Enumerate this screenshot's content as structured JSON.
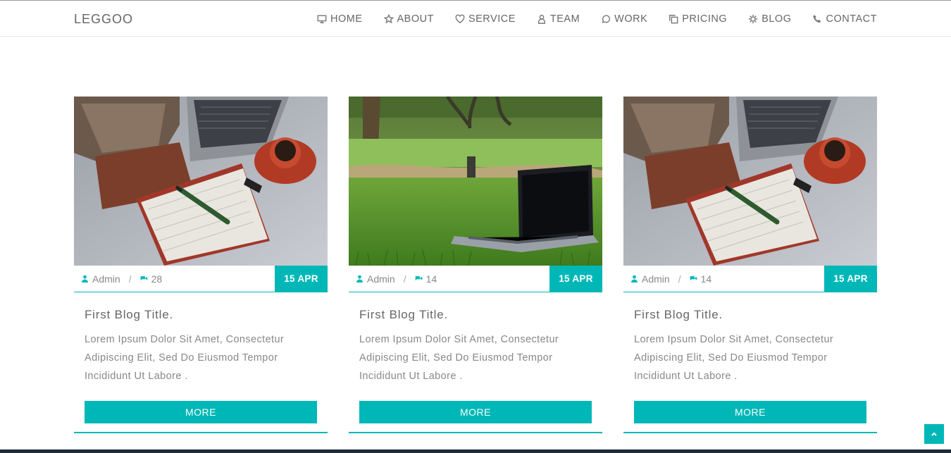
{
  "brand": "LEGGOO",
  "nav": [
    {
      "label": "HOME",
      "icon": "monitor-icon"
    },
    {
      "label": "ABOUT",
      "icon": "star-icon"
    },
    {
      "label": "SERVICE",
      "icon": "heart-icon"
    },
    {
      "label": "TEAM",
      "icon": "user-icon"
    },
    {
      "label": "WORK",
      "icon": "chat-bubble-icon"
    },
    {
      "label": "PRICING",
      "icon": "copy-icon"
    },
    {
      "label": "BLOG",
      "icon": "gear-icon"
    },
    {
      "label": "CONTACT",
      "icon": "phone-icon"
    }
  ],
  "posts": [
    {
      "image": "desk-notebook-coffee-photo",
      "author": "Admin",
      "comments": "28",
      "date": "15 APR",
      "title": "First Blog Title.",
      "desc": "Lorem Ipsum Dolor Sit Amet, Consectetur Adipiscing Elit, Sed Do Eiusmod Tempor Incididunt Ut Labore .",
      "button": "MORE"
    },
    {
      "image": "laptop-on-grass-photo",
      "author": "Admin",
      "comments": "14",
      "date": "15 APR",
      "title": "First Blog Title.",
      "desc": "Lorem Ipsum Dolor Sit Amet, Consectetur Adipiscing Elit, Sed Do Eiusmod Tempor Incididunt Ut Labore .",
      "button": "MORE"
    },
    {
      "image": "desk-notebook-coffee-photo",
      "author": "Admin",
      "comments": "14",
      "date": "15 APR",
      "title": "First Blog Title.",
      "desc": "Lorem Ipsum Dolor Sit Amet, Consectetur Adipiscing Elit, Sed Do Eiusmod Tempor Incididunt Ut Labore .",
      "button": "MORE"
    }
  ],
  "colors": {
    "accent": "#00b7b7",
    "text": "#777777",
    "nav_text": "#666666"
  }
}
